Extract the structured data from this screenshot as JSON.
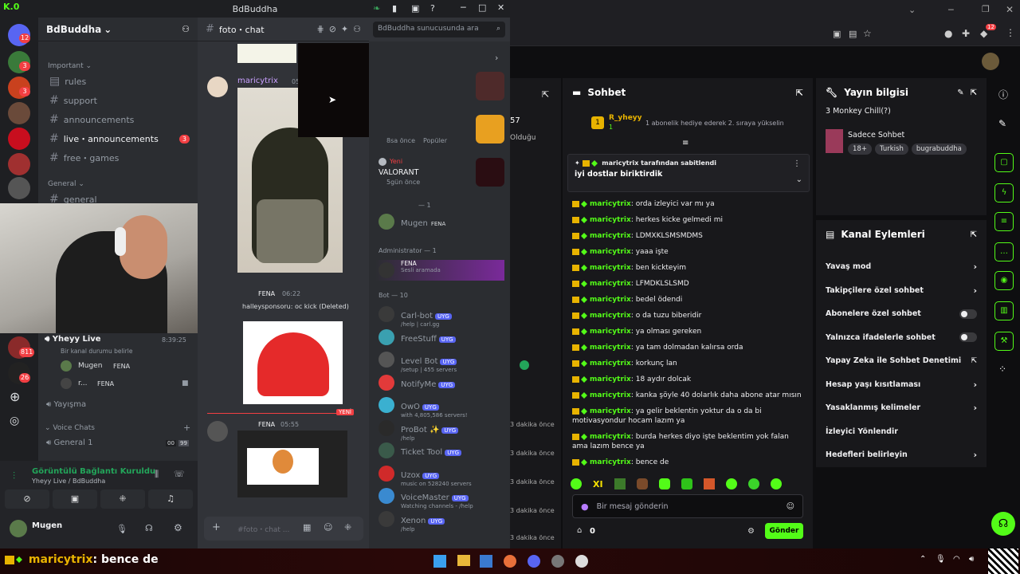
{
  "discord": {
    "window_title": "BdBuddha",
    "guild_name": "BdBuddha",
    "rail_badges": [
      "12",
      "3",
      "3",
      "811",
      "26"
    ],
    "kick_badge": "K.0",
    "categories": {
      "important": "Important",
      "general": "General",
      "voice": "Voice Chats"
    },
    "channels": [
      {
        "label": "rules",
        "unread": ""
      },
      {
        "label": "support",
        "unread": ""
      },
      {
        "label": "announcements",
        "unread": ""
      },
      {
        "label": "live・announcements",
        "unread": "3"
      },
      {
        "label": "free・games",
        "unread": ""
      },
      {
        "label": "general",
        "unread": ""
      }
    ],
    "voice": {
      "stream_title": "Yheyy Live",
      "stream_status": "Bir kanal durumu belirle",
      "time": "8:39:25",
      "members": [
        "Mugen",
        "r..."
      ],
      "fena": "FENA",
      "yayisma": "Yayışma",
      "voice_channel": "General 1",
      "voice_count": "00",
      "voice_limit": "99"
    },
    "connection": {
      "title": "Görüntülü Bağlantı Kuruldu",
      "subtitle": "Yheyy Live / BdBuddha"
    },
    "user": {
      "name": "Mugen",
      "status": ""
    },
    "chat": {
      "channel": "foto・chat",
      "search_placeholder": "BdBuddha sunucusunda ara",
      "author1": "maricytrix",
      "author1_time": "05",
      "author2": "FENA",
      "author2_time": "06:22",
      "deleted": "halleysponsoru: oc kick (Deleted)",
      "new_label": "YENİ",
      "author3": "FENA",
      "author3_time": "05:55",
      "composer_placeholder": "#foto・chat ..."
    },
    "members": {
      "activity_time": "8sa önce",
      "activity_label": "Popüler",
      "valorant_user": "Yeni",
      "valorant": "VALORANT",
      "valorant_time": "5gün önce",
      "role_header1": "— 1",
      "member_mugen": "Mugen",
      "member_mugen_tag": "FENA",
      "admin_header": "Administrator — 1",
      "admin_name": "FENA",
      "admin_sub": "Sesli aramada",
      "bot_header": "Bot — 10",
      "bots": [
        {
          "name": "Carl-bot",
          "sub": "/help | carl.gg"
        },
        {
          "name": "FreeStuff",
          "sub": ""
        },
        {
          "name": "Level Bot",
          "sub": "/setup | 455 servers"
        },
        {
          "name": "NotifyMe",
          "sub": ""
        },
        {
          "name": "OwO",
          "sub": "with 4,805,586 servers!"
        },
        {
          "name": "ProBot ✨",
          "sub": "/help"
        },
        {
          "name": "Ticket Tool",
          "sub": ""
        },
        {
          "name": "Uzox",
          "sub": "music on 528240 servers"
        },
        {
          "name": "VoiceMaster",
          "sub": "Watching channels - /help"
        },
        {
          "name": "Xenon",
          "sub": "/help"
        }
      ],
      "bot_tag": "UYG"
    }
  },
  "kick": {
    "stream_side": {
      "num": "57",
      "label": "Olduğu",
      "times": [
        "3 dakika önce",
        "3 dakika önce",
        "3 dakika önce",
        "3 dakika önce",
        "3 dakika önce"
      ]
    },
    "chat": {
      "title": "Sohbet",
      "top_user": "R_yheyy",
      "top_user_sub": "1",
      "rank": "1",
      "gift_text": "1 abonelik hediye ederek 2. sıraya yükselin",
      "pinned_by": "maricytrix tarafından sabitlendi",
      "pinned_text": "iyi dostlar biriktirdik",
      "messages": [
        {
          "user": "maricytrix",
          "text": "orda izleyici var mı ya"
        },
        {
          "user": "maricytrix",
          "text": "herkes kicke gelmedi mi"
        },
        {
          "user": "maricytrix",
          "text": "LDMXKLSMSMDMS"
        },
        {
          "user": "maricytrix",
          "text": "yaaa işte"
        },
        {
          "user": "maricytrix",
          "text": "ben kickteyim"
        },
        {
          "user": "maricytrix",
          "text": "LFMDKLSLSMD"
        },
        {
          "user": "maricytrix",
          "text": "bedel ödendi"
        },
        {
          "user": "maricytrix",
          "text": "o da tuzu biberidir"
        },
        {
          "user": "maricytrix",
          "text": "ya olması gereken"
        },
        {
          "user": "maricytrix",
          "text": "ya tam dolmadan kalırsa orda"
        },
        {
          "user": "maricytrix",
          "text": "korkunç lan"
        },
        {
          "user": "maricytrix",
          "text": "18 aydır dolcak"
        },
        {
          "user": "maricytrix",
          "text": "kanka şöyle 40 dolarlık daha abone atar mısın"
        },
        {
          "user": "maricytrix",
          "text": "ya gelir beklentin yoktur da o da bi motivasyondur hocam lazım ya"
        },
        {
          "user": "maricytrix",
          "text": "burda herkes diyo işte beklentim yok falan ama lazım bence ya"
        },
        {
          "user": "maricytrix",
          "text": "bence de"
        }
      ],
      "emotes_label": "XI",
      "input_placeholder": "Bir mesaj gönderin",
      "points": "0",
      "send": "Gönder"
    },
    "info": {
      "title": "Yayın bilgisi",
      "stream_title": "3 Monkey Chill(?)",
      "category": "Sadece Sohbet",
      "tags": [
        "18+",
        "Turkish",
        "bugrabuddha"
      ]
    },
    "actions": {
      "title": "Kanal Eylemleri",
      "items": [
        {
          "label": "Yavaş mod",
          "control": "chevron"
        },
        {
          "label": "Takipçilere özel sohbet",
          "control": "chevron"
        },
        {
          "label": "Abonelere özel sohbet",
          "control": "toggle"
        },
        {
          "label": "Yalnızca ifadelerle sohbet",
          "control": "toggle"
        },
        {
          "label": "Yapay Zeka ile Sohbet Denetimi",
          "control": "external"
        },
        {
          "label": "Hesap yaşı kısıtlaması",
          "control": "chevron"
        },
        {
          "label": "Yasaklanmış kelimeler",
          "control": "chevron"
        },
        {
          "label": "İzleyici Yönlendir",
          "control": "none"
        },
        {
          "label": "Hedefleri belirleyin",
          "control": "chevron"
        }
      ]
    }
  },
  "overlay": {
    "user": "maricytrix",
    "text": ": bence de"
  },
  "browser": {
    "ext_badge": "12"
  }
}
